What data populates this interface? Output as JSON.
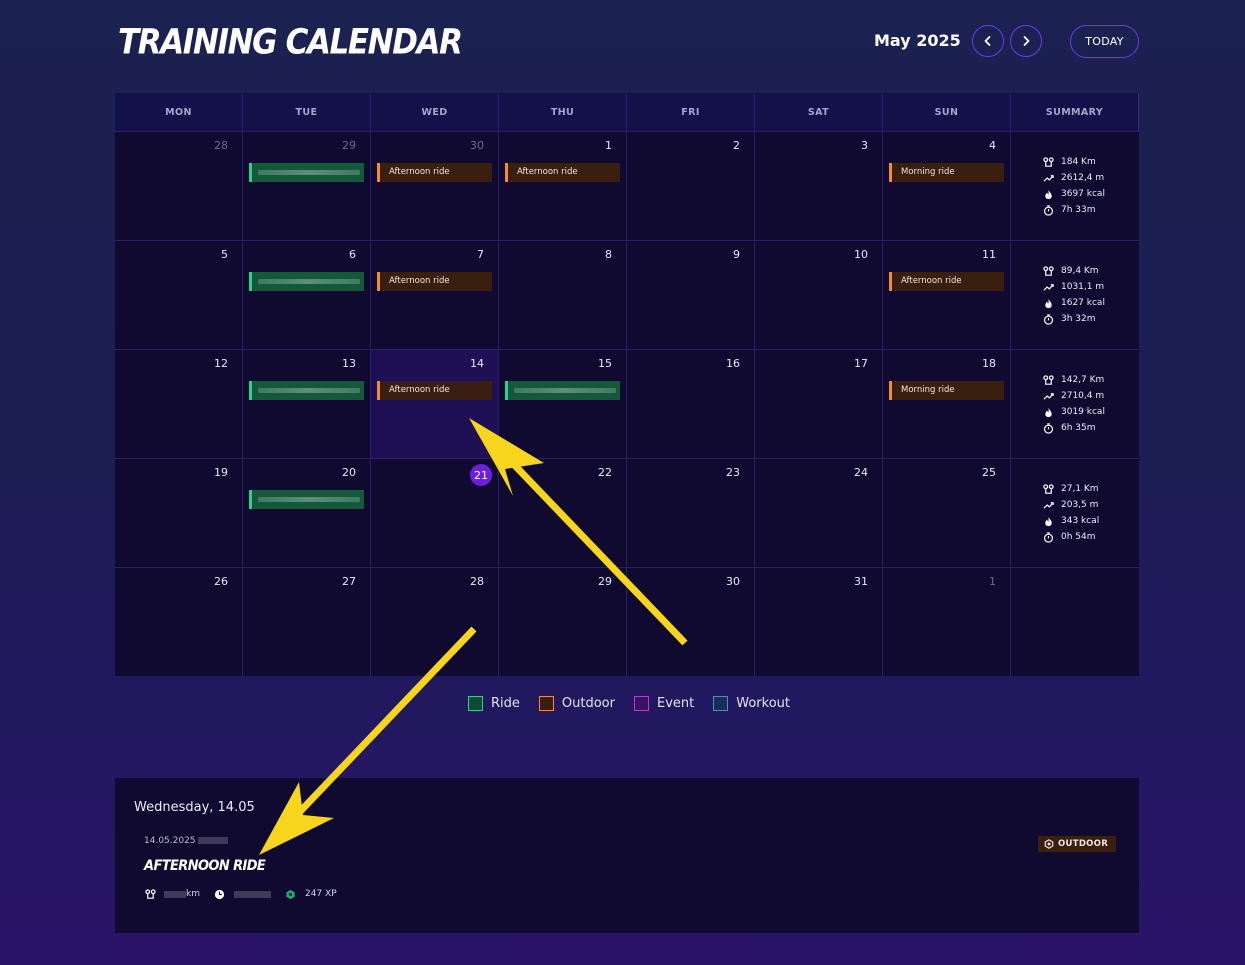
{
  "header": {
    "title": "TRAINING CALENDAR",
    "month": "May 2025",
    "today_label": "TODAY"
  },
  "calendar": {
    "weekdays": [
      "MON",
      "TUE",
      "WED",
      "THU",
      "FRI",
      "SAT",
      "SUN",
      "SUMMARY"
    ],
    "weeks": [
      {
        "days": [
          {
            "num": "28",
            "muted": true
          },
          {
            "num": "29",
            "muted": true,
            "event": {
              "type": "ride",
              "label": ""
            }
          },
          {
            "num": "30",
            "muted": true,
            "event": {
              "type": "outdoor",
              "label": "Afternoon ride"
            }
          },
          {
            "num": "1",
            "event": {
              "type": "outdoor",
              "label": "Afternoon ride"
            }
          },
          {
            "num": "2"
          },
          {
            "num": "3"
          },
          {
            "num": "4",
            "event": {
              "type": "outdoor",
              "label": "Morning ride"
            }
          }
        ],
        "summary": {
          "distance": "184 Km",
          "elevation": "2612,4 m",
          "calories": "3697 kcal",
          "time": "7h 33m"
        }
      },
      {
        "days": [
          {
            "num": "5"
          },
          {
            "num": "6",
            "event": {
              "type": "ride",
              "label": ""
            }
          },
          {
            "num": "7",
            "event": {
              "type": "outdoor",
              "label": "Afternoon ride"
            }
          },
          {
            "num": "8"
          },
          {
            "num": "9"
          },
          {
            "num": "10"
          },
          {
            "num": "11",
            "event": {
              "type": "outdoor",
              "label": "Afternoon ride"
            }
          }
        ],
        "summary": {
          "distance": "89,4 Km",
          "elevation": "1031,1 m",
          "calories": "1627 kcal",
          "time": "3h 32m"
        }
      },
      {
        "days": [
          {
            "num": "12"
          },
          {
            "num": "13",
            "event": {
              "type": "ride",
              "label": ""
            }
          },
          {
            "num": "14",
            "selected": true,
            "event": {
              "type": "outdoor",
              "label": "Afternoon ride"
            }
          },
          {
            "num": "15",
            "event": {
              "type": "ride",
              "label": ""
            }
          },
          {
            "num": "16"
          },
          {
            "num": "17"
          },
          {
            "num": "18",
            "event": {
              "type": "outdoor",
              "label": "Morning ride"
            }
          }
        ],
        "summary": {
          "distance": "142,7 Km",
          "elevation": "2710,4 m",
          "calories": "3019 kcal",
          "time": "6h 35m"
        }
      },
      {
        "days": [
          {
            "num": "19"
          },
          {
            "num": "20",
            "event": {
              "type": "ride",
              "label": ""
            }
          },
          {
            "num": "21",
            "today": true
          },
          {
            "num": "22"
          },
          {
            "num": "23"
          },
          {
            "num": "24"
          },
          {
            "num": "25"
          }
        ],
        "summary": {
          "distance": "27,1 Km",
          "elevation": "203,5 m",
          "calories": "343 kcal",
          "time": "0h 54m"
        }
      },
      {
        "days": [
          {
            "num": "26"
          },
          {
            "num": "27"
          },
          {
            "num": "28"
          },
          {
            "num": "29"
          },
          {
            "num": "30"
          },
          {
            "num": "31"
          },
          {
            "num": "1",
            "muted": true
          }
        ],
        "summary": null
      }
    ]
  },
  "legend": [
    {
      "label": "Ride",
      "color": "#2fd08a",
      "fill": "#0f4a33"
    },
    {
      "label": "Outdoor",
      "color": "#f58a3d",
      "fill": "#3a1f10"
    },
    {
      "label": "Event",
      "color": "#b03ce0",
      "fill": "#3a1360"
    },
    {
      "label": "Workout",
      "color": "#4f8ad0",
      "fill": "#163055"
    }
  ],
  "detail": {
    "date_heading": "Wednesday, 14.05",
    "activity_date": "14.05.2025",
    "activity_title": "AFTERNOON RIDE",
    "distance_unit": "km",
    "xp": "247 XP",
    "badge": "OUTDOOR"
  },
  "colors": {
    "accent": "#6b3cf0",
    "today": "#6c1fe0",
    "arrow": "#f7d51d"
  }
}
